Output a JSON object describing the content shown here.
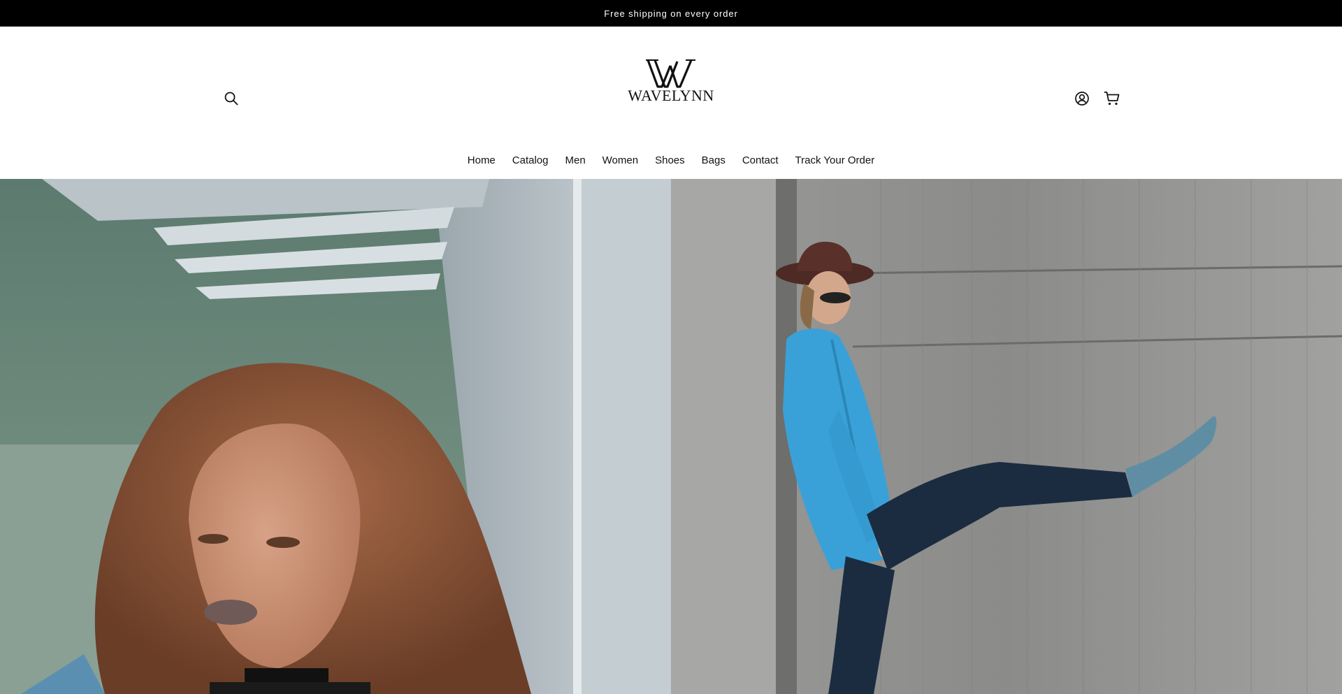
{
  "announcement": {
    "text": "Free shipping on every order"
  },
  "header": {
    "logo": {
      "text": "WAVELYNN",
      "mark": "wavelynn-w-monogram"
    },
    "icons": {
      "search": "search-icon",
      "account": "account-icon",
      "cart": "cart-icon"
    }
  },
  "nav": {
    "items": [
      {
        "label": "Home"
      },
      {
        "label": "Catalog"
      },
      {
        "label": "Men"
      },
      {
        "label": "Women"
      },
      {
        "label": "Shoes"
      },
      {
        "label": "Bags"
      },
      {
        "label": "Contact"
      },
      {
        "label": "Track Your Order"
      }
    ]
  },
  "hero": {
    "left_image": "woman-curly-hair-portrait",
    "right_image": "man-blue-blazer-against-concrete-wall"
  },
  "colors": {
    "announcement_bg": "#000000",
    "announcement_text": "#ffffff",
    "text": "#121212",
    "background": "#ffffff"
  }
}
